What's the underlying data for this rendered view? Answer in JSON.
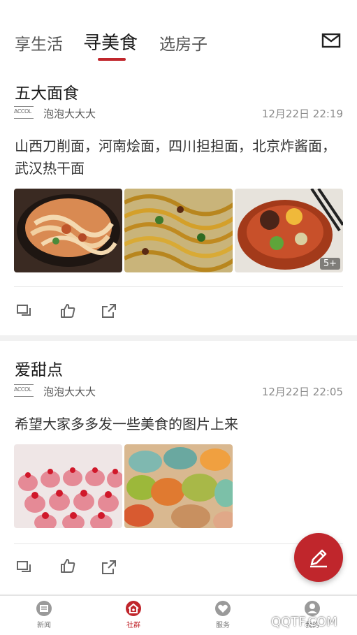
{
  "tabs": [
    {
      "label": "享生活"
    },
    {
      "label": "寻美食"
    },
    {
      "label": "选房子"
    }
  ],
  "posts": [
    {
      "title": "五大面食",
      "avatar_text": "ACCOL",
      "author": "泡泡大大大",
      "time": "12月22日 22:19",
      "content": "山西刀削面，河南烩面，四川担担面，北京炸酱面，武汉热干面",
      "more_count": "5+"
    },
    {
      "title": "爱甜点",
      "avatar_text": "ACCOL",
      "author": "泡泡大大大",
      "time": "12月22日 22:05",
      "content": "希望大家多多发一些美食的图片上来"
    }
  ],
  "bottom_nav": [
    {
      "label": "新闻"
    },
    {
      "label": "社群"
    },
    {
      "label": "服务"
    },
    {
      "label": "我的"
    }
  ],
  "watermark": "QQTF.COM",
  "colors": {
    "accent": "#c0262c"
  }
}
